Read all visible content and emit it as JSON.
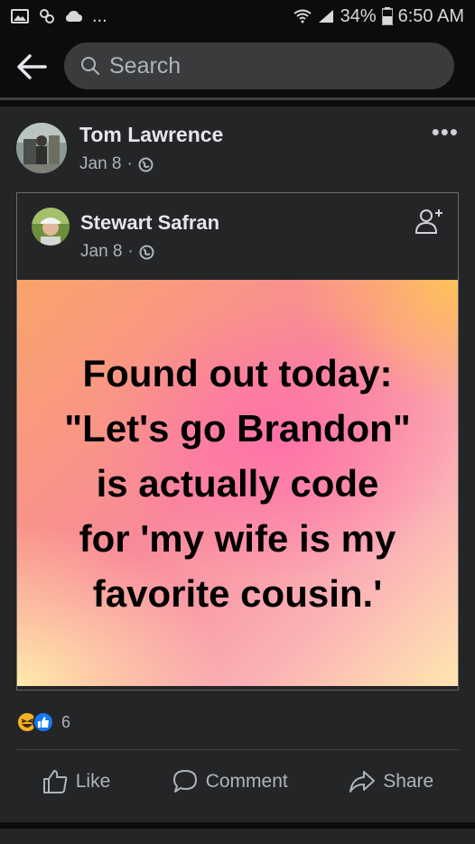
{
  "status_bar": {
    "battery": "34%",
    "time": "6:50 AM",
    "overflow": "..."
  },
  "search": {
    "placeholder": "Search"
  },
  "post": {
    "author": "Tom Lawrence",
    "date": "Jan 8",
    "separator": "·",
    "more": "•••",
    "shared": {
      "author": "Stewart Safran",
      "date": "Jan 8",
      "separator": "·",
      "text_lines": [
        "Found out today:",
        "\"Let's go Brandon\"",
        "is actually code",
        "for 'my wife is my",
        "favorite cousin.'"
      ]
    },
    "reactions": {
      "count": "6",
      "types": [
        "haha-icon",
        "like-icon"
      ]
    },
    "actions": {
      "like": "Like",
      "comment": "Comment",
      "share": "Share"
    }
  },
  "colors": {
    "background": "#0c0c0d",
    "card": "#242526",
    "accent_like": "#1877f2",
    "haha": "#f7b125"
  }
}
